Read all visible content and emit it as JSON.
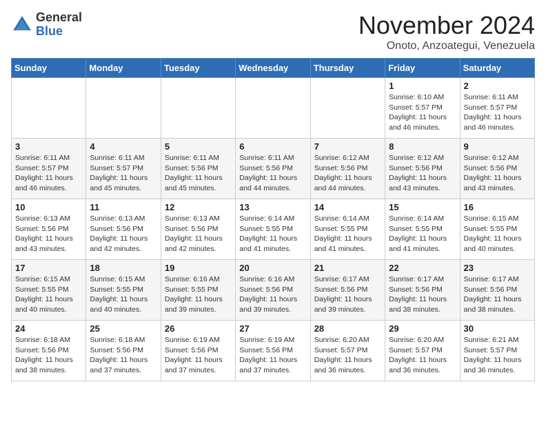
{
  "header": {
    "logo": {
      "general": "General",
      "blue": "Blue"
    },
    "title": "November 2024",
    "location": "Onoto, Anzoategui, Venezuela"
  },
  "days_of_week": [
    "Sunday",
    "Monday",
    "Tuesday",
    "Wednesday",
    "Thursday",
    "Friday",
    "Saturday"
  ],
  "weeks": [
    [
      {
        "day": "",
        "info": ""
      },
      {
        "day": "",
        "info": ""
      },
      {
        "day": "",
        "info": ""
      },
      {
        "day": "",
        "info": ""
      },
      {
        "day": "",
        "info": ""
      },
      {
        "day": "1",
        "info": "Sunrise: 6:10 AM\nSunset: 5:57 PM\nDaylight: 11 hours\nand 46 minutes."
      },
      {
        "day": "2",
        "info": "Sunrise: 6:11 AM\nSunset: 5:57 PM\nDaylight: 11 hours\nand 46 minutes."
      }
    ],
    [
      {
        "day": "3",
        "info": "Sunrise: 6:11 AM\nSunset: 5:57 PM\nDaylight: 11 hours\nand 46 minutes."
      },
      {
        "day": "4",
        "info": "Sunrise: 6:11 AM\nSunset: 5:57 PM\nDaylight: 11 hours\nand 45 minutes."
      },
      {
        "day": "5",
        "info": "Sunrise: 6:11 AM\nSunset: 5:56 PM\nDaylight: 11 hours\nand 45 minutes."
      },
      {
        "day": "6",
        "info": "Sunrise: 6:11 AM\nSunset: 5:56 PM\nDaylight: 11 hours\nand 44 minutes."
      },
      {
        "day": "7",
        "info": "Sunrise: 6:12 AM\nSunset: 5:56 PM\nDaylight: 11 hours\nand 44 minutes."
      },
      {
        "day": "8",
        "info": "Sunrise: 6:12 AM\nSunset: 5:56 PM\nDaylight: 11 hours\nand 43 minutes."
      },
      {
        "day": "9",
        "info": "Sunrise: 6:12 AM\nSunset: 5:56 PM\nDaylight: 11 hours\nand 43 minutes."
      }
    ],
    [
      {
        "day": "10",
        "info": "Sunrise: 6:13 AM\nSunset: 5:56 PM\nDaylight: 11 hours\nand 43 minutes."
      },
      {
        "day": "11",
        "info": "Sunrise: 6:13 AM\nSunset: 5:56 PM\nDaylight: 11 hours\nand 42 minutes."
      },
      {
        "day": "12",
        "info": "Sunrise: 6:13 AM\nSunset: 5:56 PM\nDaylight: 11 hours\nand 42 minutes."
      },
      {
        "day": "13",
        "info": "Sunrise: 6:14 AM\nSunset: 5:55 PM\nDaylight: 11 hours\nand 41 minutes."
      },
      {
        "day": "14",
        "info": "Sunrise: 6:14 AM\nSunset: 5:55 PM\nDaylight: 11 hours\nand 41 minutes."
      },
      {
        "day": "15",
        "info": "Sunrise: 6:14 AM\nSunset: 5:55 PM\nDaylight: 11 hours\nand 41 minutes."
      },
      {
        "day": "16",
        "info": "Sunrise: 6:15 AM\nSunset: 5:55 PM\nDaylight: 11 hours\nand 40 minutes."
      }
    ],
    [
      {
        "day": "17",
        "info": "Sunrise: 6:15 AM\nSunset: 5:55 PM\nDaylight: 11 hours\nand 40 minutes."
      },
      {
        "day": "18",
        "info": "Sunrise: 6:15 AM\nSunset: 5:55 PM\nDaylight: 11 hours\nand 40 minutes."
      },
      {
        "day": "19",
        "info": "Sunrise: 6:16 AM\nSunset: 5:55 PM\nDaylight: 11 hours\nand 39 minutes."
      },
      {
        "day": "20",
        "info": "Sunrise: 6:16 AM\nSunset: 5:56 PM\nDaylight: 11 hours\nand 39 minutes."
      },
      {
        "day": "21",
        "info": "Sunrise: 6:17 AM\nSunset: 5:56 PM\nDaylight: 11 hours\nand 39 minutes."
      },
      {
        "day": "22",
        "info": "Sunrise: 6:17 AM\nSunset: 5:56 PM\nDaylight: 11 hours\nand 38 minutes."
      },
      {
        "day": "23",
        "info": "Sunrise: 6:17 AM\nSunset: 5:56 PM\nDaylight: 11 hours\nand 38 minutes."
      }
    ],
    [
      {
        "day": "24",
        "info": "Sunrise: 6:18 AM\nSunset: 5:56 PM\nDaylight: 11 hours\nand 38 minutes."
      },
      {
        "day": "25",
        "info": "Sunrise: 6:18 AM\nSunset: 5:56 PM\nDaylight: 11 hours\nand 37 minutes."
      },
      {
        "day": "26",
        "info": "Sunrise: 6:19 AM\nSunset: 5:56 PM\nDaylight: 11 hours\nand 37 minutes."
      },
      {
        "day": "27",
        "info": "Sunrise: 6:19 AM\nSunset: 5:56 PM\nDaylight: 11 hours\nand 37 minutes."
      },
      {
        "day": "28",
        "info": "Sunrise: 6:20 AM\nSunset: 5:57 PM\nDaylight: 11 hours\nand 36 minutes."
      },
      {
        "day": "29",
        "info": "Sunrise: 6:20 AM\nSunset: 5:57 PM\nDaylight: 11 hours\nand 36 minutes."
      },
      {
        "day": "30",
        "info": "Sunrise: 6:21 AM\nSunset: 5:57 PM\nDaylight: 11 hours\nand 36 minutes."
      }
    ]
  ]
}
